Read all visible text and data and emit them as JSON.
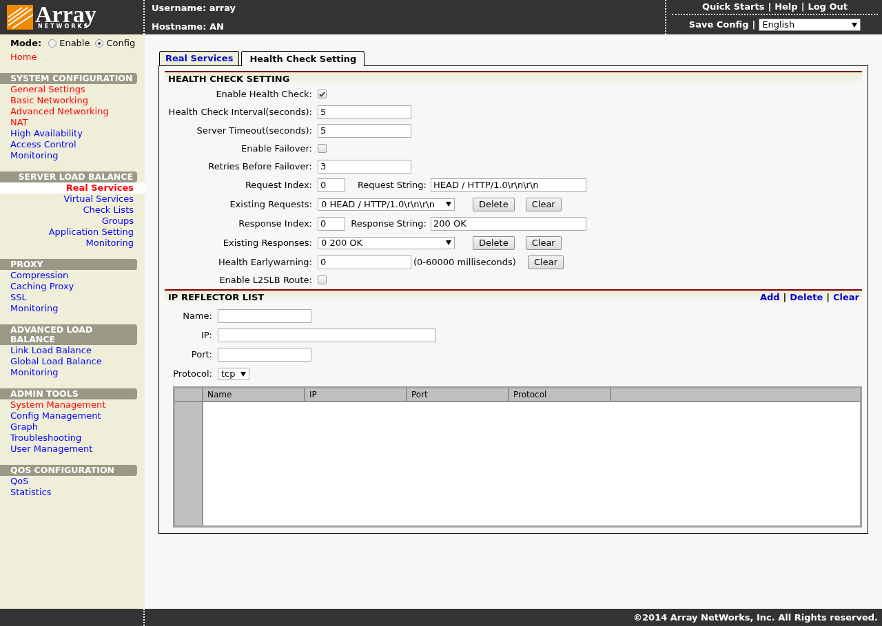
{
  "header": {
    "logo_word": "Array",
    "logo_sub": "NETWORKS",
    "username": "Username: array",
    "hostname": "Hostname: AN",
    "links": [
      "Quick Starts",
      "Help",
      "Log Out"
    ],
    "link_separators": [
      "|",
      "|"
    ],
    "save": "Save Config",
    "save_separator": "|",
    "language": "English"
  },
  "sidebar": {
    "mode_label": "Mode:",
    "modes": [
      {
        "label": "Enable",
        "selected": false
      },
      {
        "label": "Config",
        "selected": true
      }
    ],
    "home": {
      "label": "Home",
      "color": "#ff0000"
    },
    "sections": [
      {
        "title": "SYSTEM CONFIGURATION",
        "kind": "plain",
        "items": [
          {
            "label": "General Settings",
            "color": "#ff0000",
            "selected": false
          },
          {
            "label": "Basic Networking",
            "color": "#ff0000",
            "selected": false
          },
          {
            "label": "Advanced Networking",
            "color": "#ff0000",
            "selected": false
          },
          {
            "label": "NAT",
            "color": "#ff0000",
            "selected": false
          },
          {
            "label": "High Availability",
            "color": "#0000ff",
            "selected": false
          },
          {
            "label": "Access Control",
            "color": "#0000ff",
            "selected": false
          },
          {
            "label": "Monitoring",
            "color": "#0000ff",
            "selected": false
          }
        ]
      },
      {
        "title": "SERVER LOAD BALANCE",
        "kind": "indented",
        "items": [
          {
            "label": "Real Services",
            "color": "#ff0000",
            "selected": true
          },
          {
            "label": "Virtual Services",
            "color": "#0000ff",
            "selected": false
          },
          {
            "label": "Check Lists",
            "color": "#0000ff",
            "selected": false
          },
          {
            "label": "Groups",
            "color": "#0000ff",
            "selected": false
          },
          {
            "label": "Application Setting",
            "color": "#0000ff",
            "selected": false
          },
          {
            "label": "Monitoring",
            "color": "#0000ff",
            "selected": false
          }
        ]
      },
      {
        "title": "PROXY",
        "kind": "plain",
        "items": [
          {
            "label": "Compression",
            "color": "#0000ff",
            "selected": false
          },
          {
            "label": "Caching Proxy",
            "color": "#0000ff",
            "selected": false
          },
          {
            "label": "SSL",
            "color": "#0000ff",
            "selected": false
          },
          {
            "label": "Monitoring",
            "color": "#0000ff",
            "selected": false
          }
        ]
      },
      {
        "title": "ADVANCED LOAD BALANCE",
        "kind": "plain",
        "items": [
          {
            "label": "Link Load Balance",
            "color": "#0000ff",
            "selected": false
          },
          {
            "label": "Global Load Balance",
            "color": "#0000ff",
            "selected": false
          },
          {
            "label": "Monitoring",
            "color": "#0000ff",
            "selected": false
          }
        ]
      },
      {
        "title": "ADMIN TOOLS",
        "kind": "plain",
        "items": [
          {
            "label": "System Management",
            "color": "#ff0000",
            "selected": false
          },
          {
            "label": "Config Management",
            "color": "#0000ff",
            "selected": false
          },
          {
            "label": "Graph",
            "color": "#0000ff",
            "selected": false
          },
          {
            "label": "Troubleshooting",
            "color": "#0000ff",
            "selected": false
          },
          {
            "label": "User Management",
            "color": "#0000ff",
            "selected": false
          }
        ]
      },
      {
        "title": "QOS CONFIGURATION",
        "kind": "plain",
        "items": [
          {
            "label": "QoS",
            "color": "#0000ff",
            "selected": false
          },
          {
            "label": "Statistics",
            "color": "#0000ff",
            "selected": false
          }
        ]
      }
    ]
  },
  "tabs": [
    {
      "label": "Real Services",
      "selected": false
    },
    {
      "label": "Health Check Setting",
      "selected": true
    }
  ],
  "health_check": {
    "title": "HEALTH CHECK SETTING",
    "rows": [
      {
        "kind": "checkbox",
        "label": "Enable Health Check:",
        "checked": true
      },
      {
        "kind": "text",
        "label": "Health Check Interval(seconds):",
        "value": "5"
      },
      {
        "kind": "text",
        "label": "Server Timeout(seconds):",
        "value": "5"
      },
      {
        "kind": "checkbox",
        "label": "Enable Failover:",
        "checked": false
      },
      {
        "kind": "text",
        "label": "Retries Before Failover:",
        "value": "3"
      },
      {
        "kind": "pair",
        "label": "Request Index:",
        "value": "0",
        "label2": "Request String:",
        "value2": "HEAD / HTTP/1.0\\r\\n\\r\\n"
      },
      {
        "kind": "select",
        "label": "Existing Requests:",
        "value": "0 HEAD / HTTP/1.0\\r\\n\\r\\n",
        "buttons": [
          "Delete",
          "Clear"
        ]
      },
      {
        "kind": "pair",
        "label": "Response Index:",
        "value": "0",
        "label2": "Response String:",
        "value2": "200 OK"
      },
      {
        "kind": "select",
        "label": "Existing Responses:",
        "value": "0 200 OK",
        "buttons": [
          "Delete",
          "Clear"
        ]
      },
      {
        "kind": "note",
        "label": "Health Earlywarning:",
        "value": "0",
        "note": "(0-60000 milliseconds)",
        "buttons": [
          "Clear"
        ]
      },
      {
        "kind": "checkbox",
        "label": "Enable L2SLB Route:",
        "checked": false
      }
    ]
  },
  "ip_reflector": {
    "title": "IP REFLECTOR LIST",
    "actions": [
      "Add",
      "Delete",
      "Clear"
    ],
    "action_separators": [
      "|",
      "|"
    ],
    "fields": [
      {
        "kind": "short",
        "label": "Name:"
      },
      {
        "kind": "long",
        "label": "IP:"
      },
      {
        "kind": "short",
        "label": "Port:"
      },
      {
        "kind": "select",
        "label": "Protocol:",
        "value": "tcp"
      }
    ],
    "table": {
      "columns": [
        "Name",
        "IP",
        "Port",
        "Protocol"
      ]
    }
  },
  "footer": "©2014 Array NetWorks, Inc. All Rights reserved."
}
